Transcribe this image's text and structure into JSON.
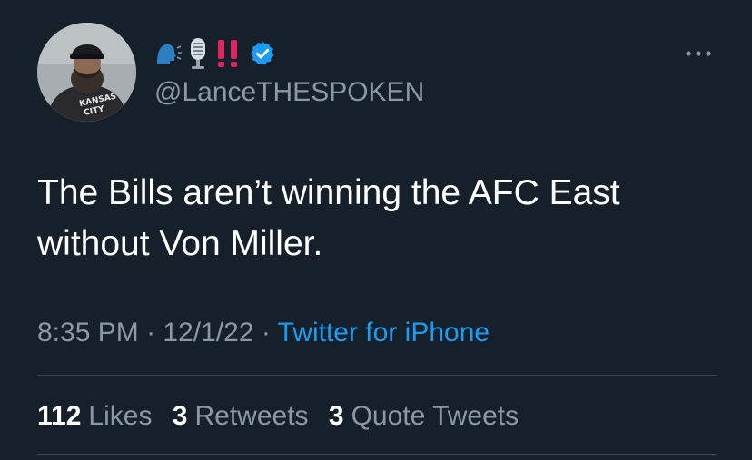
{
  "tweet": {
    "handle": "@LanceTHESPOKEN",
    "name_emojis": [
      "speaking-head-emoji",
      "microphone-emoji",
      "double-exclamation-emoji"
    ],
    "verified_icon": "verified-badge-icon",
    "more_icon": "more-options-icon",
    "text_line1": "The Bills aren’t winning the AFC East",
    "text_line2": "without Von Miller.",
    "time": "8:35 PM",
    "sep1": " · ",
    "date": "12/1/22",
    "sep2": " · ",
    "source": "Twitter for iPhone"
  },
  "stats": {
    "likes_count": "112",
    "likes_label": "Likes",
    "retweets_count": "3",
    "retweets_label": "Retweets",
    "quotes_count": "3",
    "quotes_label": "Quote Tweets"
  },
  "colors": {
    "background": "#15202b",
    "text_primary": "#ffffff",
    "text_secondary": "#8b98a5",
    "link": "#1d9bf0",
    "verified": "#1d9bf0",
    "exclamation": "#e0245e",
    "divider": "#38444d"
  },
  "avatar": {
    "shirt_text_line1": "KANSAS",
    "shirt_text_line2": "CITY"
  }
}
